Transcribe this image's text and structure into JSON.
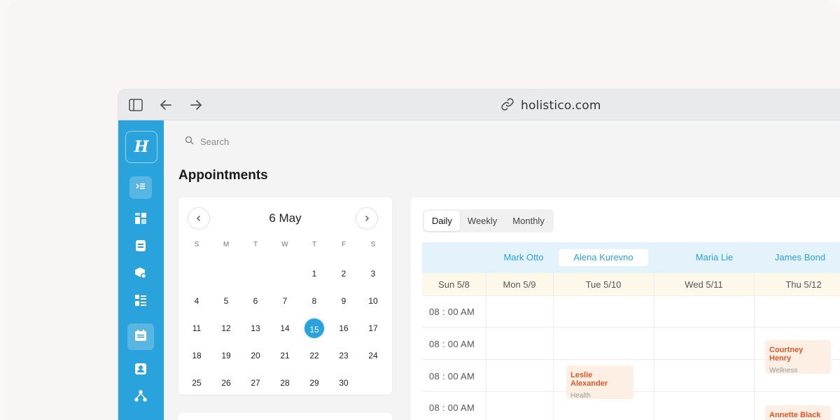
{
  "browser": {
    "url": "holistico.com"
  },
  "app": {
    "logo_letter": "H",
    "search_placeholder": "Search",
    "page_title": "Appointments"
  },
  "calendar": {
    "month_label": "6 May",
    "weekdays": [
      "S",
      "M",
      "T",
      "W",
      "T",
      "F",
      "S"
    ],
    "weeks": [
      [
        "",
        "",
        "",
        "",
        "1",
        "2",
        "3"
      ],
      [
        "4",
        "5",
        "6",
        "7",
        "8",
        "9",
        "10"
      ],
      [
        "11",
        "12",
        "13",
        "14",
        "15",
        "16",
        "17"
      ],
      [
        "18",
        "19",
        "20",
        "21",
        "22",
        "23",
        "24"
      ],
      [
        "25",
        "26",
        "27",
        "28",
        "29",
        "30",
        ""
      ]
    ],
    "selected_day": "15"
  },
  "schedule": {
    "tabs": [
      {
        "label": "Daily",
        "active": true
      },
      {
        "label": "Weekly",
        "active": false
      },
      {
        "label": "Monthly",
        "active": false
      }
    ],
    "people": [
      {
        "name": "Mark Otto",
        "active": false
      },
      {
        "name": "Alena Kurevno",
        "active": true
      },
      {
        "name": "Maria Lie",
        "active": false
      },
      {
        "name": "James Bond",
        "active": false
      }
    ],
    "dates": [
      "Sun 5/8",
      "Mon 5/9",
      "Tue 5/10",
      "Wed 5/11",
      "Thu 5/12"
    ],
    "times": [
      "08 : 00 AM",
      "08 : 00 AM",
      "08 : 00 AM",
      "08 : 00 AM"
    ],
    "events": [
      {
        "name": "Courtney Henry",
        "category": "Wellness"
      },
      {
        "name": "Leslie Alexander",
        "category": "Health"
      },
      {
        "name": "Annette Black",
        "category": ""
      }
    ]
  },
  "colors": {
    "accent": "#2aa2dc",
    "event_text": "#e0572a",
    "event_bg": "#fdefe3",
    "date_row_bg": "#fdf8ea",
    "person_row_bg": "#e4f3fb"
  }
}
